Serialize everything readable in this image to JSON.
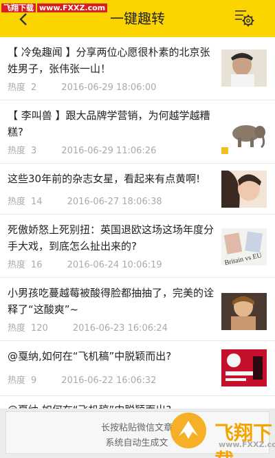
{
  "header": {
    "title": "一键趣转",
    "back_icon": "back-arrow-icon",
    "settings_icon": "gear-icon",
    "background": "#fcd400"
  },
  "watermark": {
    "label": "飞翔下载",
    "url": "www.FXXZ.com"
  },
  "feed": {
    "items": [
      {
        "title": "【 冷兔趣闻 】分享两位心愿很朴素的北京张姓男子，张伟张一山！",
        "views_label": "热度",
        "views": "2",
        "date": "2016-06-29 18:06:00",
        "thumb": "portrait-photo"
      },
      {
        "title": "【 李叫兽 】跟大品牌学营销，为何越学越糟糕?",
        "views_label": "热度",
        "views": "3",
        "date": "2016-06-29 11:06:26",
        "thumb": "elephant-photo"
      },
      {
        "title": "这些30年前的杂志女星，看起来有点黄啊!",
        "views_label": "热度",
        "views": "14",
        "date": "2016-06-27 18:06:38",
        "thumb": "magazine-photo"
      },
      {
        "title": "死傲娇怒上死别扭：英国退欧这场这场年度分手大戏，到底怎么扯出来的?",
        "views_label": "热度",
        "views": "16",
        "date": "2016-06-24 10:06:19",
        "thumb": "britain-vs-eu-photo",
        "thumb_text": "Britain vs EU"
      },
      {
        "title": "小男孩吃蔓越莓被酸得脸都抽抽了，完美的诠释了“这酸爽”~",
        "views_label": "热度",
        "views": "120",
        "date": "2016-06-23 16:06:24",
        "thumb": "boy-photo"
      },
      {
        "title": "@戛纳,如何在“飞机稿”中脱颖而出?",
        "views_label": "热度",
        "views": "9",
        "date": "2016-06-22 16:06:32",
        "thumb": "ad-poster-photo"
      },
      {
        "title": "@戛纳,如何在“飞机稿”中脱颖而出?",
        "views_label": "热度",
        "views": "",
        "date": "",
        "thumb": ""
      }
    ]
  },
  "banner": {
    "line1": "长按粘贴微信文章",
    "line2": "系统自动生成文",
    "logo_text": "飞翔下载",
    "logo_url": "www.FXXZ.com"
  }
}
